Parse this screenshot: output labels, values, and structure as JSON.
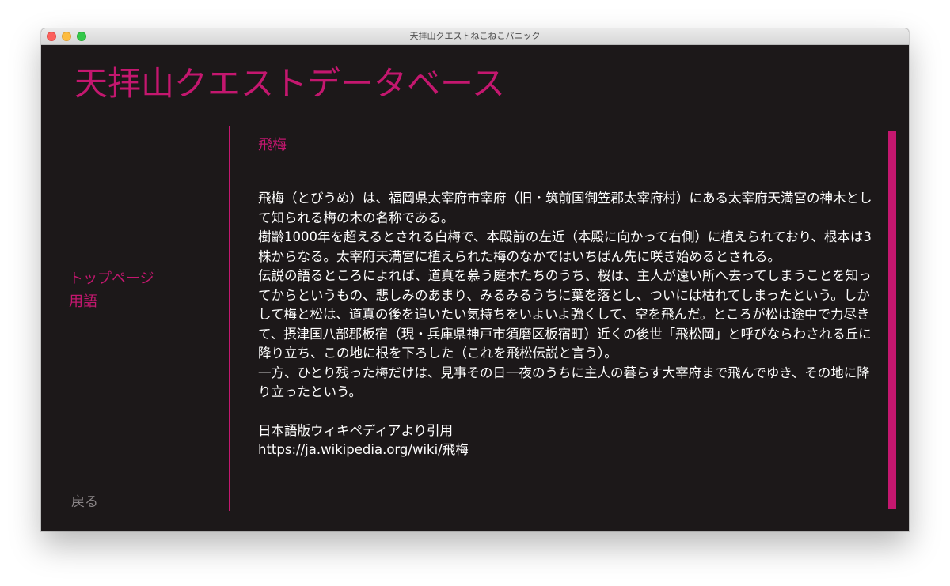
{
  "window": {
    "title": "天拝山クエストねこねこパニック"
  },
  "app": {
    "title": "天拝山クエストデータベース"
  },
  "nav": {
    "items": [
      {
        "label": "トップページ"
      },
      {
        "label": "用語"
      }
    ],
    "back_label": "戻る"
  },
  "entry": {
    "title": "飛梅",
    "paragraphs": [
      "飛梅（とびうめ）は、福岡県太宰府市宰府（旧・筑前国御笠郡太宰府村）にある太宰府天満宮の神木として知られる梅の木の名称である。",
      "樹齢1000年を超えるとされる白梅で、本殿前の左近（本殿に向かって右側）に植えられており、根本は3株からなる。太宰府天満宮に植えられた梅のなかではいちばん先に咲き始めるとされる。",
      "伝説の語るところによれば、道真を慕う庭木たちのうち、桜は、主人が遠い所へ去ってしまうことを知ってからというもの、悲しみのあまり、みるみるうちに葉を落とし、ついには枯れてしまったという。しかして梅と松は、道真の後を追いたい気持ちをいよいよ強くして、空を飛んだ。ところが松は途中で力尽きて、摂津国八部郡板宿（現・兵庫県神戸市須磨区板宿町）近くの後世「飛松岡」と呼びならわされる丘に降り立ち、この地に根を下ろした（これを飛松伝説と言う）。",
      "一方、ひとり残った梅だけは、見事その日一夜のうちに主人の暮らす大宰府まで飛んでゆき、その地に降り立ったという。"
    ],
    "source_label": "日本語版ウィキペディアより引用",
    "source_url": "https://ja.wikipedia.org/wiki/飛梅"
  },
  "colors": {
    "accent": "#c4176f",
    "background": "#1c1819",
    "text": "#ffffff",
    "muted": "#8a8587"
  }
}
